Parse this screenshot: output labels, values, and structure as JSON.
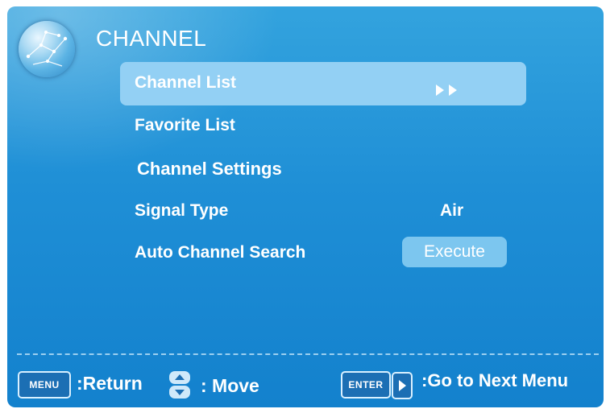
{
  "menu": {
    "title": "CHANNEL",
    "items": [
      {
        "label": "Channel List",
        "value": "",
        "selected": true,
        "has_submenu": true
      },
      {
        "label": "Favorite List",
        "value": ""
      },
      {
        "label": "Channel Settings",
        "value": ""
      },
      {
        "label": "Signal Type",
        "value": "Air"
      },
      {
        "label": "Auto Channel Search",
        "value": "Execute"
      }
    ]
  },
  "footer": {
    "menu_key": "MENU",
    "menu_hint": ":Return",
    "move_hint": ": Move",
    "enter_key": "ENTER",
    "enter_hint": ":Go to Next Menu"
  },
  "colors": {
    "background": "#1f8fd6",
    "highlight": "#93d0f4",
    "button": "#7cc6ef",
    "text": "#ffffff"
  },
  "icons": [
    "globe-icon",
    "double-right-arrow-icon",
    "up-down-arrow-icon",
    "right-arrow-icon"
  ]
}
